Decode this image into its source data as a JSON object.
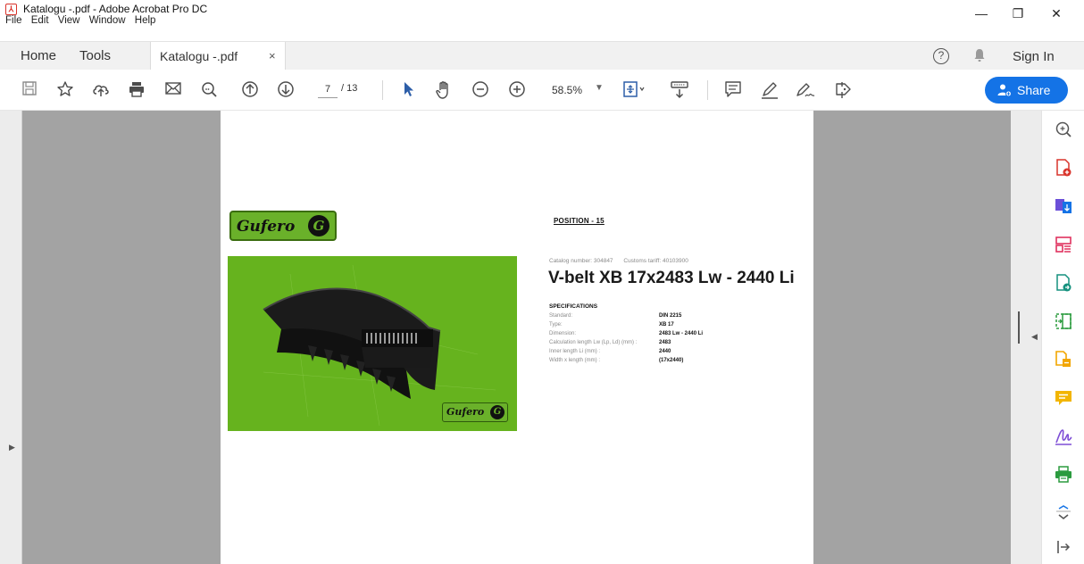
{
  "window": {
    "title": "Katalogu -.pdf - Adobe Acrobat Pro DC",
    "controls": {
      "minimize": "—",
      "restore": "❐",
      "close": "✕"
    }
  },
  "menu": [
    "File",
    "Edit",
    "View",
    "Window",
    "Help"
  ],
  "tabs": {
    "home": "Home",
    "tools": "Tools",
    "document": "Katalogu -.pdf",
    "close": "×",
    "sign_in": "Sign In",
    "help": "?"
  },
  "toolbar": {
    "page_current": "7",
    "page_total": "/ 13",
    "zoom": "58.5%",
    "share_label": "Share"
  },
  "page": {
    "logo_text": "Gufero",
    "logo_mark": "G",
    "position_label": "POSITION - 15",
    "catalog_number": "Catalog number: 304847",
    "customs_tariff": "Customs tariff: 40103900",
    "title": "V-belt XB 17x2483 Lw - 2440 Li",
    "spec_heading": "SPECIFICATIONS",
    "specs": [
      {
        "label": "Standard:",
        "value": "DIN 2215"
      },
      {
        "label": "Type:",
        "value": "XB 17"
      },
      {
        "label": "Dimension:",
        "value": "2483 Lw - 2440 Li"
      },
      {
        "label": "Calculation length Lw (Lp, Ld) (mm) :",
        "value": "2483"
      },
      {
        "label": "Inner length Li (mm) :",
        "value": "2440"
      },
      {
        "label": "Width x length (mm) :",
        "value": "(17x2440)"
      }
    ]
  },
  "colors": {
    "accent": "#1473e6",
    "product_bg": "#66b31e",
    "workspace": "#a3a3a3",
    "pdf_icon_red": "#d9342b"
  },
  "icons": {
    "toolbar": [
      "save-icon",
      "bookmark-star-icon",
      "upload-cloud-icon",
      "print-icon",
      "email-icon",
      "zoom-search-icon",
      "page-up-icon",
      "page-down-icon",
      "select-arrow-icon",
      "hand-icon",
      "zoom-out-icon",
      "zoom-in-icon",
      "fit-page-icon",
      "scroll-mode-icon",
      "comment-icon",
      "highlight-pen-icon",
      "sign-icon",
      "fill-sign-icon"
    ],
    "right_panel": [
      "search-zoom-icon",
      "create-pdf-icon",
      "export-pdf-icon",
      "organize-pages-icon",
      "edit-pdf-icon",
      "compress-icon",
      "combine-files-icon",
      "comment-tool-icon",
      "fill-sign-tool-icon",
      "print-production-icon",
      "expand-icon",
      "panel-collapse-icon"
    ]
  }
}
